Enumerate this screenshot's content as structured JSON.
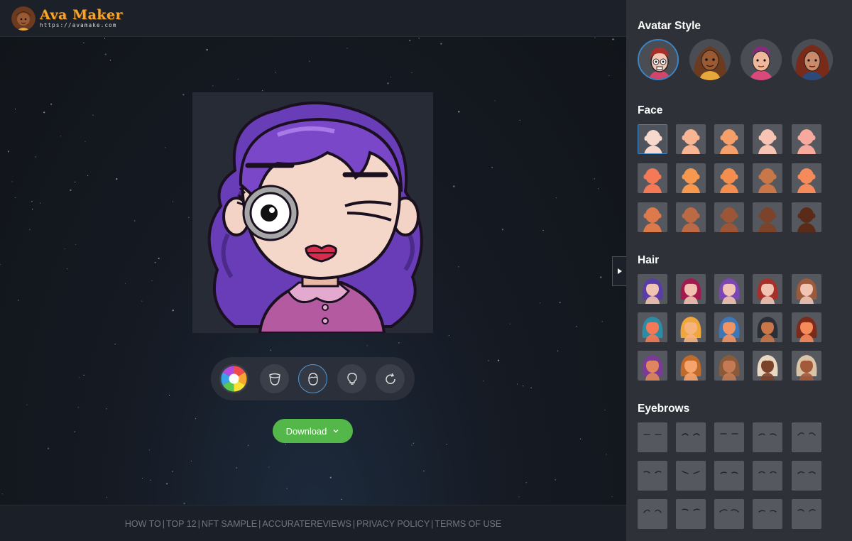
{
  "app": {
    "logo_title": "Ava Maker",
    "logo_url": "https://avamake.com"
  },
  "toolbar": {
    "tools": [
      {
        "name": "color-wheel-icon"
      },
      {
        "name": "face-shape-icon"
      },
      {
        "name": "head-icon",
        "active": true
      },
      {
        "name": "lightbulb-icon"
      },
      {
        "name": "refresh-icon"
      }
    ]
  },
  "download": {
    "label": "Download"
  },
  "footer": {
    "links": [
      "HOW TO",
      "TOP 12",
      "NFT SAMPLE",
      "ACCURATEREVIEWS",
      "PRIVACY POLICY",
      "TERMS OF USE"
    ],
    "separator": "|"
  },
  "panel": {
    "avatar_style": {
      "title": "Avatar Style",
      "selected_index": 0
    },
    "face": {
      "title": "Face",
      "skin_colors": [
        "#f6d8cc",
        "#f7b594",
        "#f5a06b",
        "#f7c3b2",
        "#f6a99c",
        "#f47a57",
        "#f7984f",
        "#f38e4f",
        "#c97748",
        "#f58a5a",
        "#dd7a4c",
        "#bb6a45",
        "#9a5636",
        "#7b432a",
        "#5a2b18"
      ],
      "selected_index": 0
    },
    "hair": {
      "title": "Hair",
      "styles": [
        {
          "hair": "#5a3ca8",
          "skin": "#f1c3b3"
        },
        {
          "hair": "#a31a4e",
          "skin": "#f2c0b0"
        },
        {
          "hair": "#7b47b5",
          "skin": "#f1c3b3"
        },
        {
          "hair": "#a8302a",
          "skin": "#f1c3b3"
        },
        {
          "hair": "#9c5a3c",
          "skin": "#f1c3b3"
        },
        {
          "hair": "#2c8ca5",
          "skin": "#f47a57"
        },
        {
          "hair": "#f0a63a",
          "skin": "#f7b37c"
        },
        {
          "hair": "#3d77b8",
          "skin": "#f09464"
        },
        {
          "hair": "#2a2f38",
          "skin": "#c97748"
        },
        {
          "hair": "#7c2a1a",
          "skin": "#f58a5a"
        },
        {
          "hair": "#7a3b96",
          "skin": "#e0865e"
        },
        {
          "hair": "#c06a2c",
          "skin": "#f7a46c"
        },
        {
          "hair": "#8a5a3a",
          "skin": "#c47a52"
        },
        {
          "hair": "#e9d9c2",
          "skin": "#7b432a"
        },
        {
          "hair": "#d9c4a8",
          "skin": "#a35a3a"
        }
      ]
    },
    "eyebrows": {
      "title": "Eyebrows",
      "count": 15
    }
  }
}
